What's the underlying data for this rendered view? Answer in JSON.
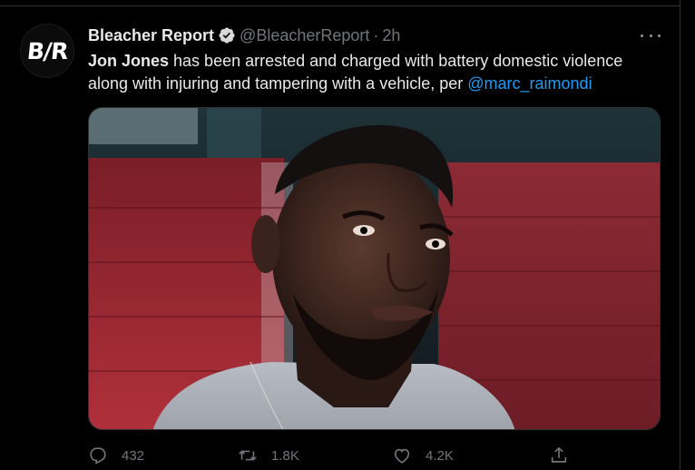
{
  "tweet": {
    "avatar_text": "B/R",
    "display_name": "Bleacher Report",
    "handle": "@BleacherReport",
    "separator": "·",
    "time": "2h",
    "text_bold": "Jon Jones",
    "text_body": " has been arrested and charged with battery domestic violence along with injuring and tampering with a vehicle, per ",
    "mention": "@marc_raimondi"
  },
  "actions": {
    "replies": "432",
    "retweets": "1.8K",
    "likes": "4.2K"
  },
  "icons": {
    "verified": "verified-badge-icon",
    "more": "more-options-icon",
    "reply": "reply-icon",
    "retweet": "retweet-icon",
    "like": "heart-icon",
    "share": "share-icon"
  },
  "colors": {
    "background": "#000000",
    "text": "#e7e9ea",
    "muted": "#71767b",
    "link": "#1d9bf0",
    "border": "#2f3336"
  }
}
